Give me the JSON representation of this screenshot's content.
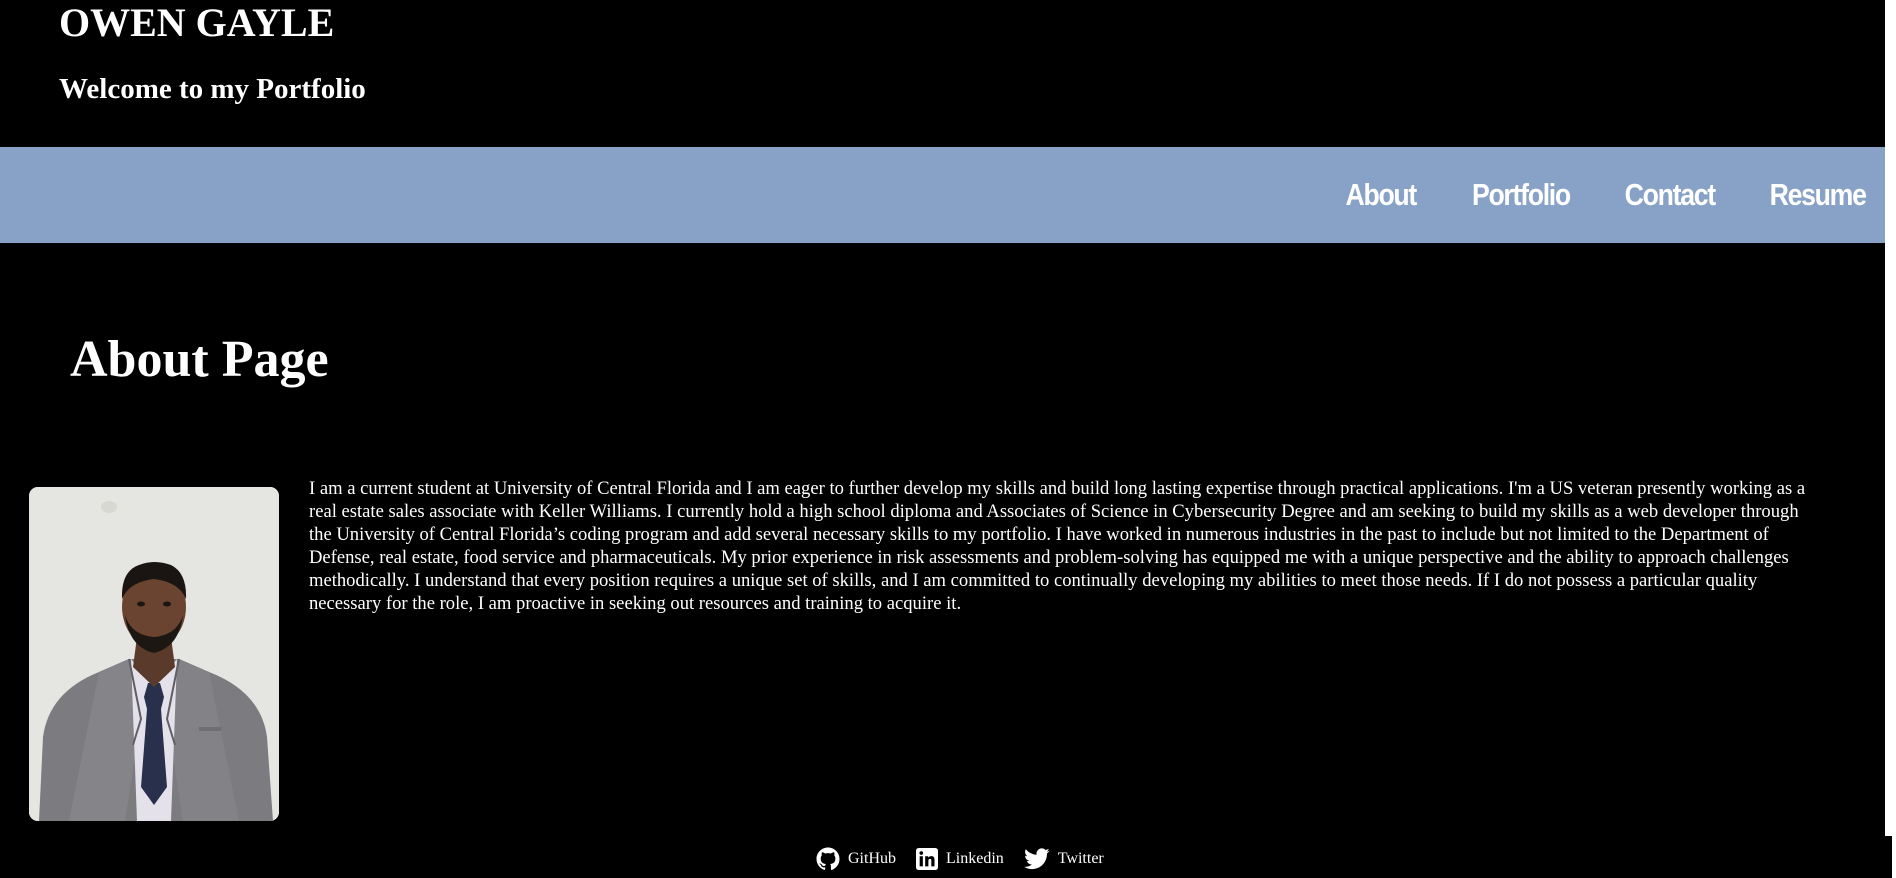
{
  "header": {
    "title": "OWEN GAYLE",
    "subtitle": "Welcome to my Portfolio"
  },
  "nav": {
    "background": "#87a2c6",
    "items": [
      {
        "label": "About"
      },
      {
        "label": "Portfolio"
      },
      {
        "label": "Contact"
      },
      {
        "label": "Resume"
      }
    ]
  },
  "main": {
    "heading": "About Page",
    "photo_icon": "profile-photo",
    "about": "I am a current student at University of Central Florida and I am eager to further develop my skills and build long lasting expertise through practical applications. I'm a US veteran presently working as a real estate sales associate with Keller Williams. I currently hold a high school diploma and Associates of Science in Cybersecurity Degree and am seeking to build my skills as a web developer through the University of Central Florida’s coding program and add several necessary skills to my portfolio. I have worked in numerous industries in the past to include but not limited to the Department of Defense, real estate, food service and pharmaceuticals. My prior experience in risk assessments and problem-solving has equipped me with a unique perspective and the ability to approach challenges methodically. I understand that every position requires a unique set of skills, and I am committed to continually developing my abilities to meet those needs. If I do not possess a particular quality necessary for the role, I am proactive in seeking out resources and training to acquire it."
  },
  "footer": {
    "links": [
      {
        "label": "GitHub",
        "icon": "github-icon"
      },
      {
        "label": "Linkedin",
        "icon": "linkedin-icon"
      },
      {
        "label": "Twitter",
        "icon": "twitter-icon"
      }
    ]
  }
}
